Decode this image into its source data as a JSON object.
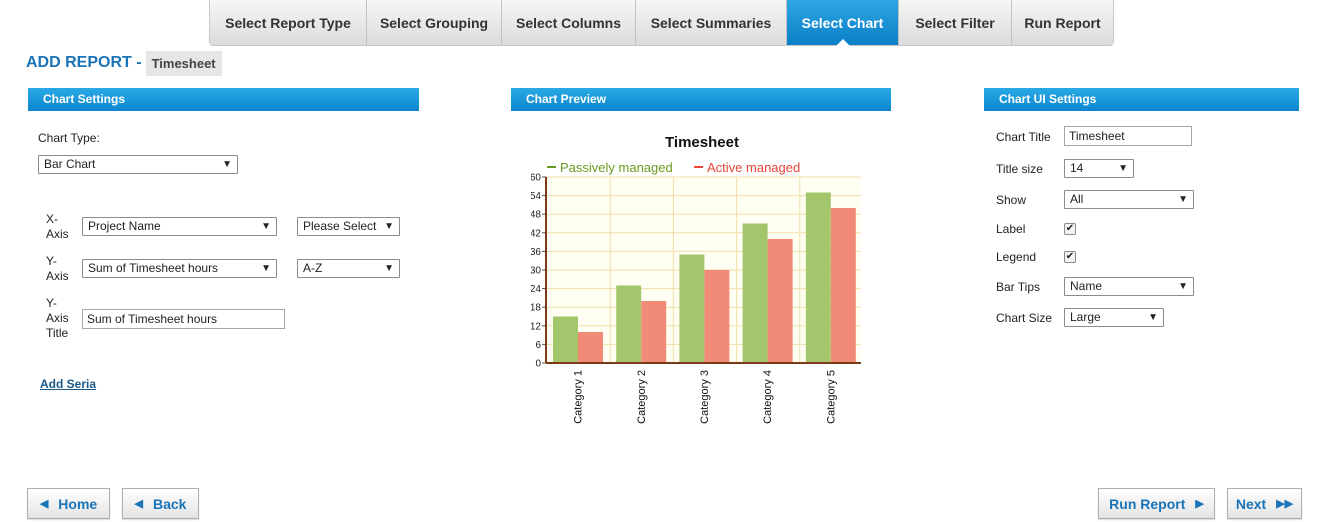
{
  "wizard": {
    "tabs": [
      {
        "label": "Select Report Type",
        "width": 157
      },
      {
        "label": "Select Grouping",
        "width": 135
      },
      {
        "label": "Select Columns",
        "width": 134
      },
      {
        "label": "Select Summaries",
        "width": 151
      },
      {
        "label": "Select Chart",
        "width": 112,
        "active": true
      },
      {
        "label": "Select Filter",
        "width": 113
      },
      {
        "label": "Run Report",
        "width": 101
      }
    ]
  },
  "heading": {
    "title": "ADD REPORT -",
    "report_name": "Timesheet"
  },
  "chart_settings": {
    "header": "Chart Settings",
    "chart_type_label": "Chart Type:",
    "chart_type_value": "Bar Chart",
    "x_axis_label": "X-Axis",
    "x_axis_field": "Project Name",
    "x_axis_sort": "Please Select",
    "y_axis_label": "Y-Axis",
    "y_axis_field": "Sum of Timesheet hours",
    "y_axis_sort": "A-Z",
    "y_axis_title_label": "Y-Axis Title",
    "y_axis_title_value": "Sum of Timesheet hours",
    "add_seria": "Add Seria"
  },
  "chart_preview": {
    "header": "Chart Preview"
  },
  "chart_ui_settings": {
    "header": "Chart UI Settings",
    "chart_title_label": "Chart Title",
    "chart_title_value": "Timesheet",
    "title_size_label": "Title size",
    "title_size_value": "14",
    "show_label": "Show",
    "show_value": "All",
    "label_label": "Label",
    "label_checked": true,
    "legend_label": "Legend",
    "legend_checked": true,
    "bar_tips_label": "Bar Tips",
    "bar_tips_value": "Name",
    "chart_size_label": "Chart Size",
    "chart_size_value": "Large"
  },
  "footer": {
    "home": "Home",
    "back": "Back",
    "run_report": "Run Report",
    "next": "Next"
  },
  "chart_data": {
    "type": "bar",
    "title": "Timesheet",
    "categories": [
      "Category 1",
      "Category 2",
      "Category 3",
      "Category 4",
      "Category 5"
    ],
    "series": [
      {
        "name": "Passively managed",
        "values": [
          15,
          25,
          35,
          45,
          55
        ],
        "color": "#a3c66c",
        "legend_color": "#6b9a1f"
      },
      {
        "name": "Active managed",
        "values": [
          10,
          20,
          30,
          40,
          50
        ],
        "color": "#f28a78",
        "legend_color": "#e8453c"
      }
    ],
    "yticks": [
      0,
      6,
      12,
      18,
      24,
      30,
      36,
      42,
      48,
      54,
      60
    ],
    "ylim": [
      0,
      60
    ],
    "grid": true,
    "legend_position": "top-left"
  }
}
